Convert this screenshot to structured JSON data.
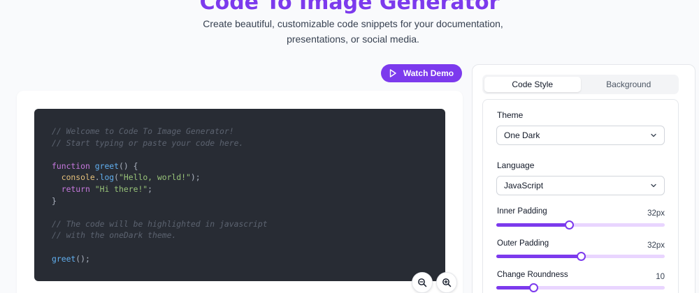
{
  "header": {
    "title": "Code To Image Generator",
    "subtitle": "Create beautiful, customizable code snippets for your documentation, presentations, or social media."
  },
  "watch_demo": {
    "label": "Watch Demo",
    "icon": "play-icon"
  },
  "code": {
    "lines": [
      [
        {
          "t": "// Welcome to Code To Image Generator!",
          "c": "comment"
        }
      ],
      [
        {
          "t": "// Start typing or paste your code here.",
          "c": "comment"
        }
      ],
      [],
      [
        {
          "t": "function",
          "c": "keyword"
        },
        {
          "t": " ",
          "c": "punc"
        },
        {
          "t": "greet",
          "c": "func"
        },
        {
          "t": "() {",
          "c": "punc"
        }
      ],
      [
        {
          "t": "  ",
          "c": "punc"
        },
        {
          "t": "console",
          "c": "obj"
        },
        {
          "t": ".",
          "c": "punc"
        },
        {
          "t": "log",
          "c": "func"
        },
        {
          "t": "(",
          "c": "punc"
        },
        {
          "t": "\"Hello, world!\"",
          "c": "str"
        },
        {
          "t": ");",
          "c": "punc"
        }
      ],
      [
        {
          "t": "  ",
          "c": "punc"
        },
        {
          "t": "return",
          "c": "keyword"
        },
        {
          "t": " ",
          "c": "punc"
        },
        {
          "t": "\"Hi there!\"",
          "c": "str"
        },
        {
          "t": ";",
          "c": "punc"
        }
      ],
      [
        {
          "t": "}",
          "c": "punc"
        }
      ],
      [],
      [
        {
          "t": "// The code will be highlighted in javascript",
          "c": "comment"
        }
      ],
      [
        {
          "t": "// with the oneDark theme.",
          "c": "comment"
        }
      ],
      [],
      [
        {
          "t": "greet",
          "c": "func"
        },
        {
          "t": "();",
          "c": "punc"
        }
      ]
    ]
  },
  "zoom": {
    "out_icon": "zoom-out-icon",
    "in_icon": "zoom-in-icon"
  },
  "tabs": [
    {
      "label": "Code Style",
      "active": true
    },
    {
      "label": "Background",
      "active": false
    }
  ],
  "settings": {
    "theme": {
      "label": "Theme",
      "value": "One Dark"
    },
    "language": {
      "label": "Language",
      "value": "JavaScript"
    },
    "inner_padding": {
      "label": "Inner Padding",
      "value_text": "32px",
      "fraction": 0.43
    },
    "outer_padding": {
      "label": "Outer Padding",
      "value_text": "32px",
      "fraction": 0.5
    },
    "roundness": {
      "label": "Change Roundness",
      "value_text": "10",
      "fraction": 0.22
    }
  },
  "colors": {
    "accent": "#7c3aed",
    "accent_light": "#e9d5ff",
    "code_bg": "#282c34"
  }
}
